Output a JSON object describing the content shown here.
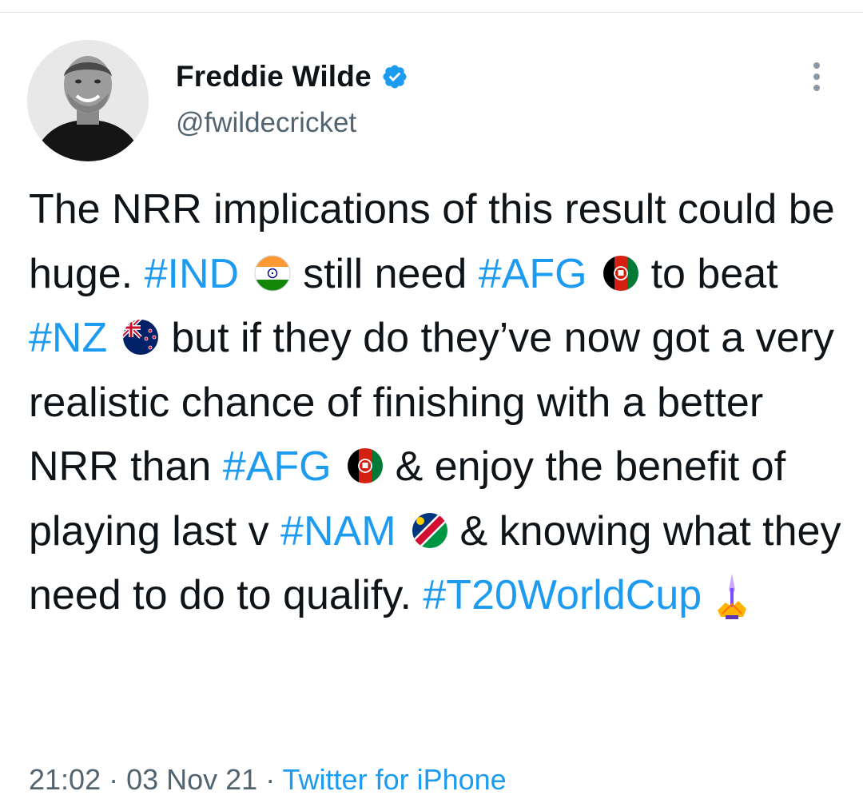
{
  "author": {
    "display_name": "Freddie Wilde",
    "handle": "@fwildecricket",
    "verified": true,
    "avatar_icon": "profile-photo"
  },
  "tweet": {
    "segments": [
      {
        "text": "The NRR implications of this result could be huge. "
      },
      {
        "text": "#IND",
        "hashtag": true
      },
      {
        "flag": "india-flag-icon"
      },
      {
        "text": "still need "
      },
      {
        "text": "#AFG",
        "hashtag": true
      },
      {
        "flag": "afghanistan-flag-icon"
      },
      {
        "text": "to beat "
      },
      {
        "text": "#NZ",
        "hashtag": true
      },
      {
        "flag": "new-zealand-flag-icon"
      },
      {
        "text": "but if they do they’ve now got a very realistic chance of finishing with a better NRR than "
      },
      {
        "text": "#AFG",
        "hashtag": true
      },
      {
        "flag": "afghanistan-flag-icon"
      },
      {
        "text": "& enjoy the benefit of playing last v "
      },
      {
        "text": "#NAM",
        "hashtag": true
      },
      {
        "flag": "namibia-flag-icon"
      },
      {
        "text": "& knowing what they need to do to qualify. "
      },
      {
        "text": "#T20WorldCup",
        "hashtag": true
      },
      {
        "flag": "t20-trophy-icon"
      }
    ]
  },
  "meta": {
    "time": "21:02",
    "separator": " · ",
    "date": "03 Nov 21",
    "source": "Twitter for iPhone"
  },
  "colors": {
    "link": "#1d9bf0",
    "text": "#0f1419",
    "muted": "#536471"
  }
}
